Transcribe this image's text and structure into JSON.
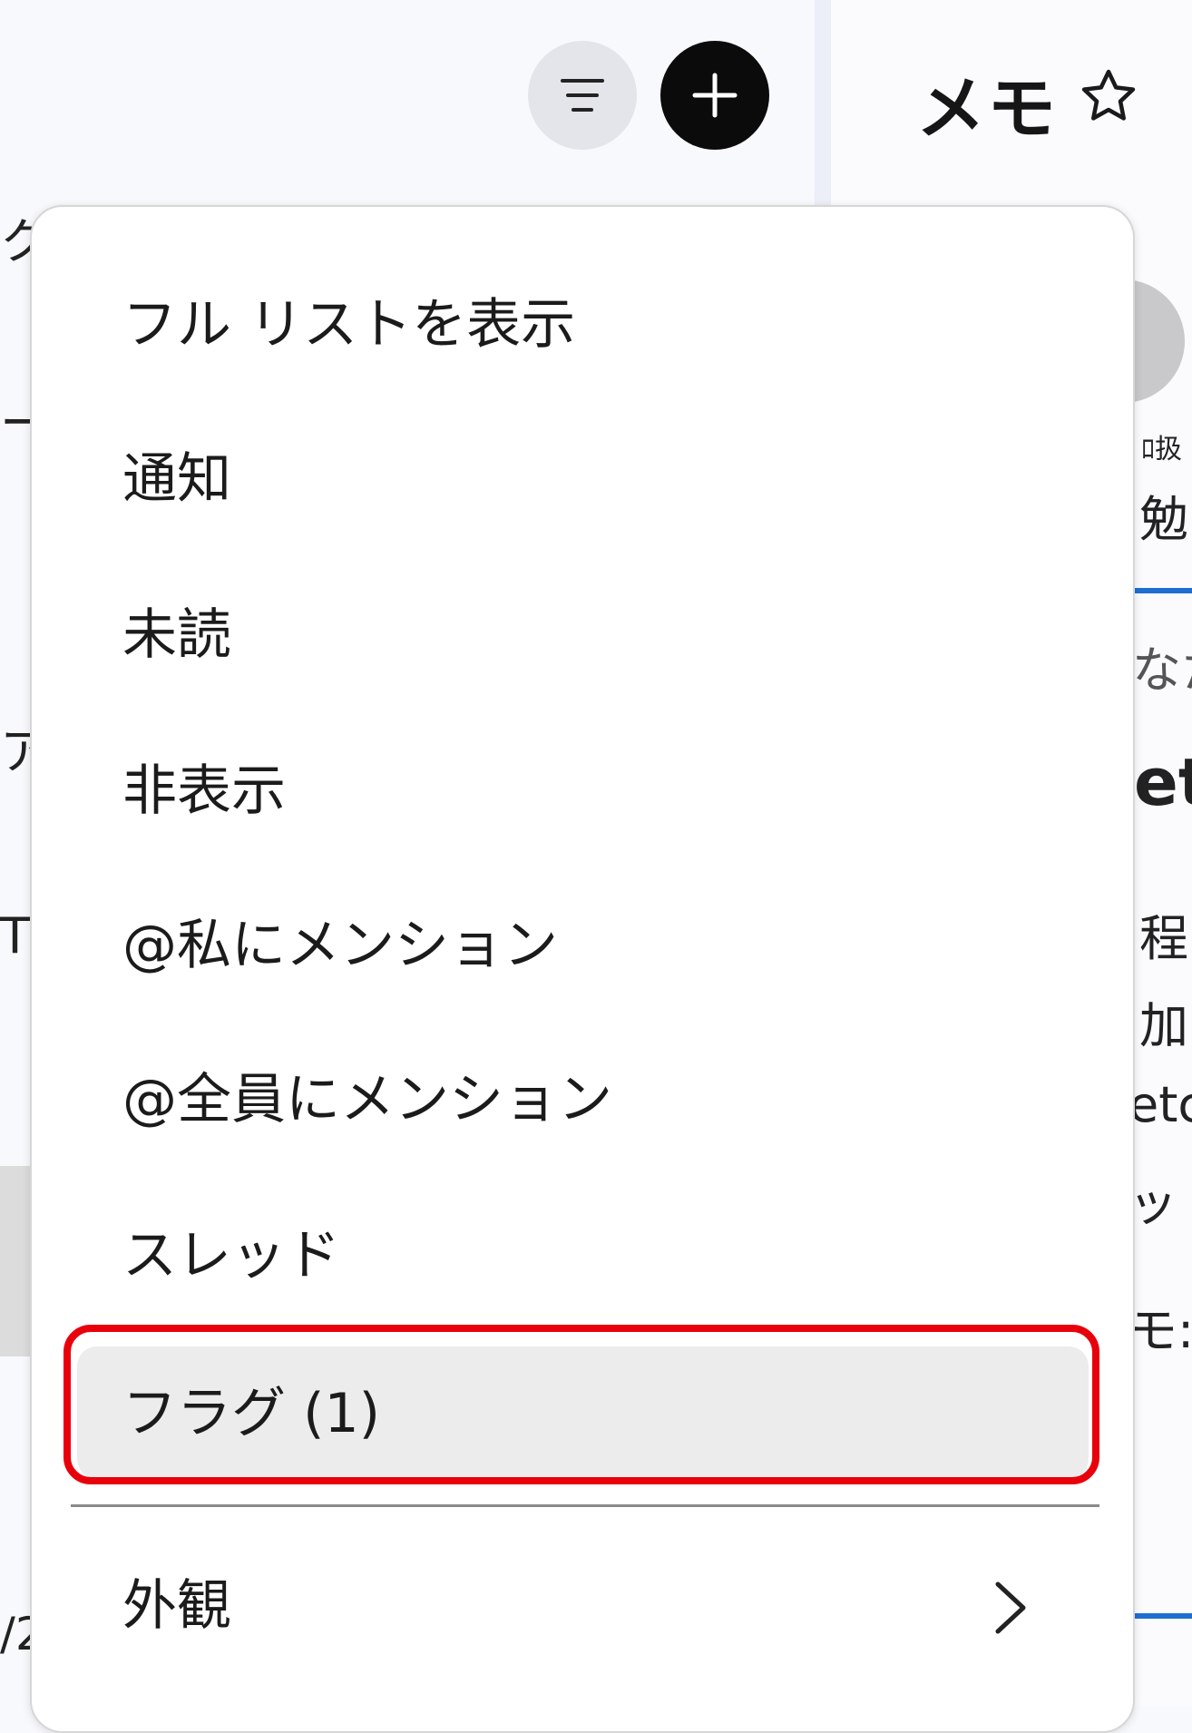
{
  "background": {
    "left_fragments": [
      "ク",
      "ー",
      "ア",
      "T",
      "/2"
    ],
    "right_panel": {
      "title": "メモ",
      "fragments": [
        "ﾛ扱",
        "勉",
        "なた",
        "et",
        "程",
        "加",
        "etc",
        "ット",
        "モ:"
      ]
    }
  },
  "toolbar": {
    "filter_icon": "filter-lines-icon",
    "add_icon": "plus-icon",
    "star_icon": "star-outline-icon"
  },
  "menu": {
    "items": [
      {
        "label": "フル リストを表示"
      },
      {
        "label": "通知"
      },
      {
        "label": "未読"
      },
      {
        "label": "非表示"
      },
      {
        "label": "@私にメンション"
      },
      {
        "label": "@全員にメンション"
      },
      {
        "label": "スレッド"
      },
      {
        "label": "フラグ (1)",
        "selected": true
      }
    ],
    "appearance": {
      "label": "外観",
      "icon": "chevron-right-icon"
    }
  },
  "colors": {
    "highlight": "#e8000b",
    "selected_bg": "#ececec",
    "add_button": "#0b0b0b",
    "accent_line": "#1f6fd1"
  }
}
